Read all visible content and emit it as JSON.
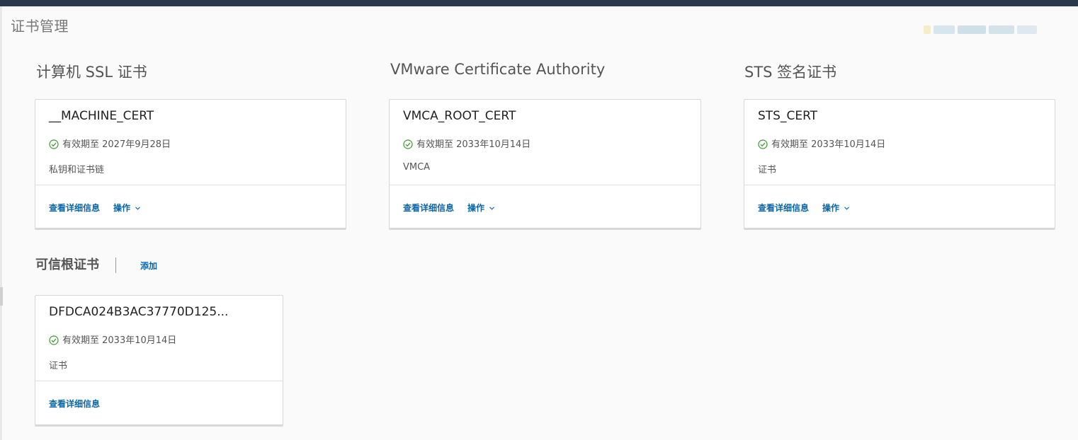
{
  "page": {
    "title": "证书管理"
  },
  "sections": [
    {
      "title": "计算机 SSL 证书",
      "card": {
        "name": "__MACHINE_CERT",
        "valid": "有效期至 2027年9月28日",
        "type": "私钥和证书链",
        "details_label": "查看详细信息",
        "actions_label": "操作"
      }
    },
    {
      "title": "VMware Certificate Authority",
      "card": {
        "name": "VMCA_ROOT_CERT",
        "valid": "有效期至 2033年10月14日",
        "type": "VMCA",
        "details_label": "查看详细信息",
        "actions_label": "操作"
      }
    },
    {
      "title": "STS 签名证书",
      "card": {
        "name": "STS_CERT",
        "valid": "有效期至 2033年10月14日",
        "type": "证书",
        "details_label": "查看详细信息",
        "actions_label": "操作"
      }
    }
  ],
  "trusted": {
    "title": "可信根证书",
    "add_label": "添加",
    "cards": [
      {
        "name": "DFDCA024B3AC37770D125...",
        "valid": "有效期至 2033年10月14日",
        "type": "证书",
        "details_label": "查看详细信息"
      }
    ]
  },
  "icons": {
    "valid": "check-circle-icon",
    "dropdown": "chevron-down-icon"
  },
  "colors": {
    "topbar": "#2a3a4a",
    "link": "#0b66a8",
    "valid_check": "#3b9b2f"
  }
}
